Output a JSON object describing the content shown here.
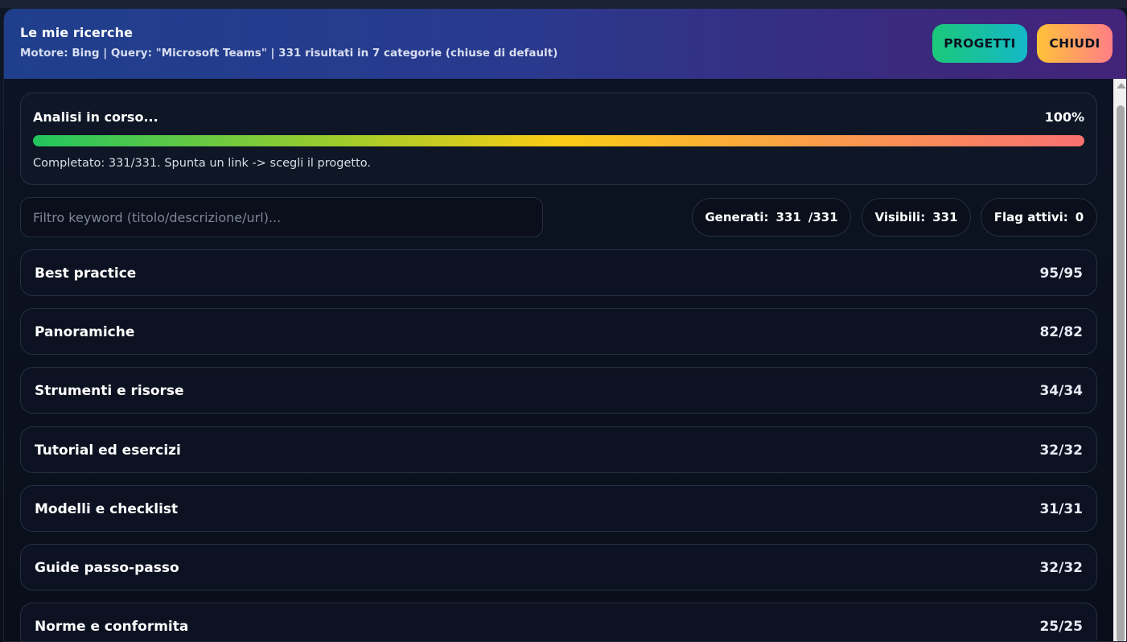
{
  "header": {
    "title": "Le mie ricerche",
    "subtitle": "Motore: Bing | Query: \"Microsoft Teams\" | 331 risultati in 7 categorie (chiuse di default)",
    "btn_progetti": "PROGETTI",
    "btn_chiudi": "CHIUDI"
  },
  "progress": {
    "title": "Analisi in corso...",
    "percent_label": "100%",
    "value": 1.0,
    "note": "Completato: 331/331. Spunta un link -> scegli il progetto."
  },
  "filter": {
    "placeholder": "Filtro keyword (titolo/descrizione/url)...",
    "value": ""
  },
  "stats": {
    "generati_label": "Generati:",
    "generati_value": "331",
    "generati_total": "/331",
    "visibili_label": "Visibili:",
    "visibili_value": "331",
    "flag_label": "Flag attivi:",
    "flag_value": "0"
  },
  "categories": [
    {
      "name": "Best practice",
      "count": "95/95"
    },
    {
      "name": "Panoramiche",
      "count": "82/82"
    },
    {
      "name": "Strumenti e risorse",
      "count": "34/34"
    },
    {
      "name": "Tutorial ed esercizi",
      "count": "32/32"
    },
    {
      "name": "Modelli e checklist",
      "count": "31/31"
    },
    {
      "name": "Guide passo-passo",
      "count": "32/32"
    },
    {
      "name": "Norme e conformita",
      "count": "25/25"
    }
  ]
}
